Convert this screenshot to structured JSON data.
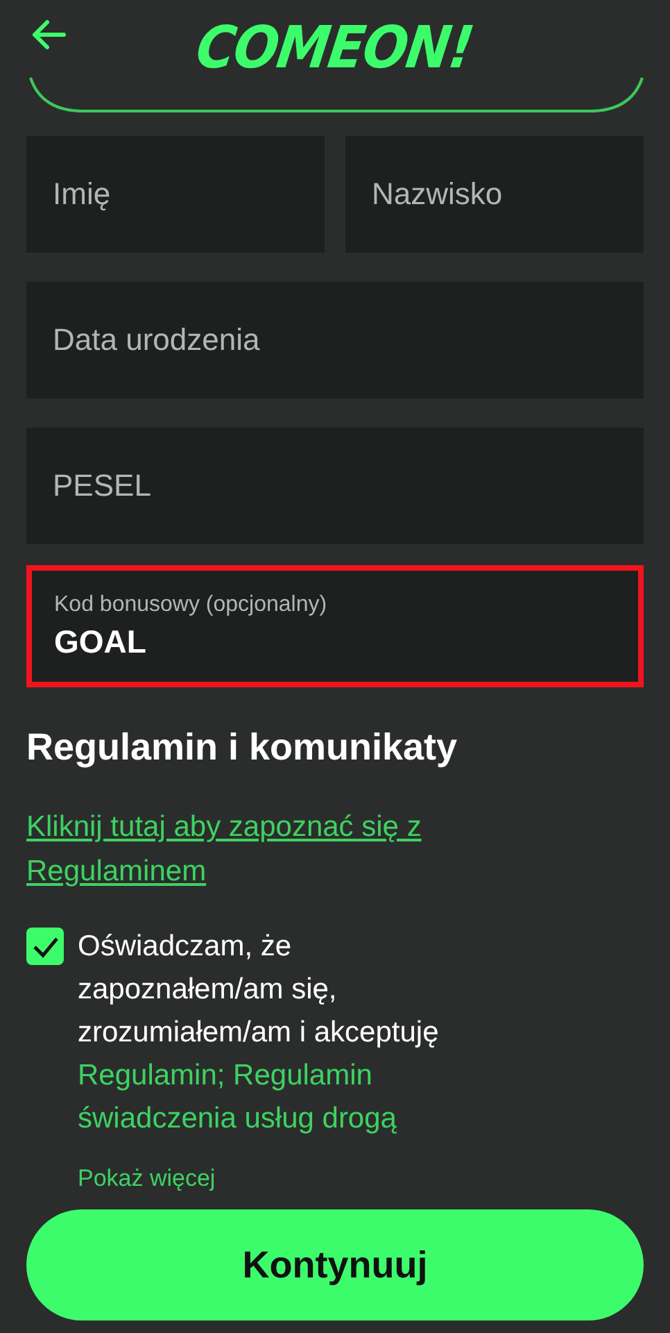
{
  "header": {
    "logo": "COMEON!"
  },
  "field_rows": [
    [
      {
        "placeholder": "Imię"
      },
      {
        "placeholder": "Nazwisko"
      }
    ],
    [
      {
        "placeholder": "Data urodzenia"
      }
    ],
    [
      {
        "placeholder": "PESEL"
      }
    ]
  ],
  "bonus_field": {
    "label": "Kod bonusowy (opcjonalny)",
    "value": "GOAL",
    "highlighted": true
  },
  "terms": {
    "heading": "Regulamin i komunikaty",
    "link": "Kliknij tutaj aby zapoznać się z Regulaminem",
    "consent": {
      "checked": true,
      "text": "Oświadczam, że zapoznałem/am się, zrozumiałem/am i akceptuję",
      "links": "Regulamin; Regulamin świadczenia usług drogą"
    },
    "show_more": "Pokaż więcej"
  },
  "continue_button": "Kontynuuj"
}
